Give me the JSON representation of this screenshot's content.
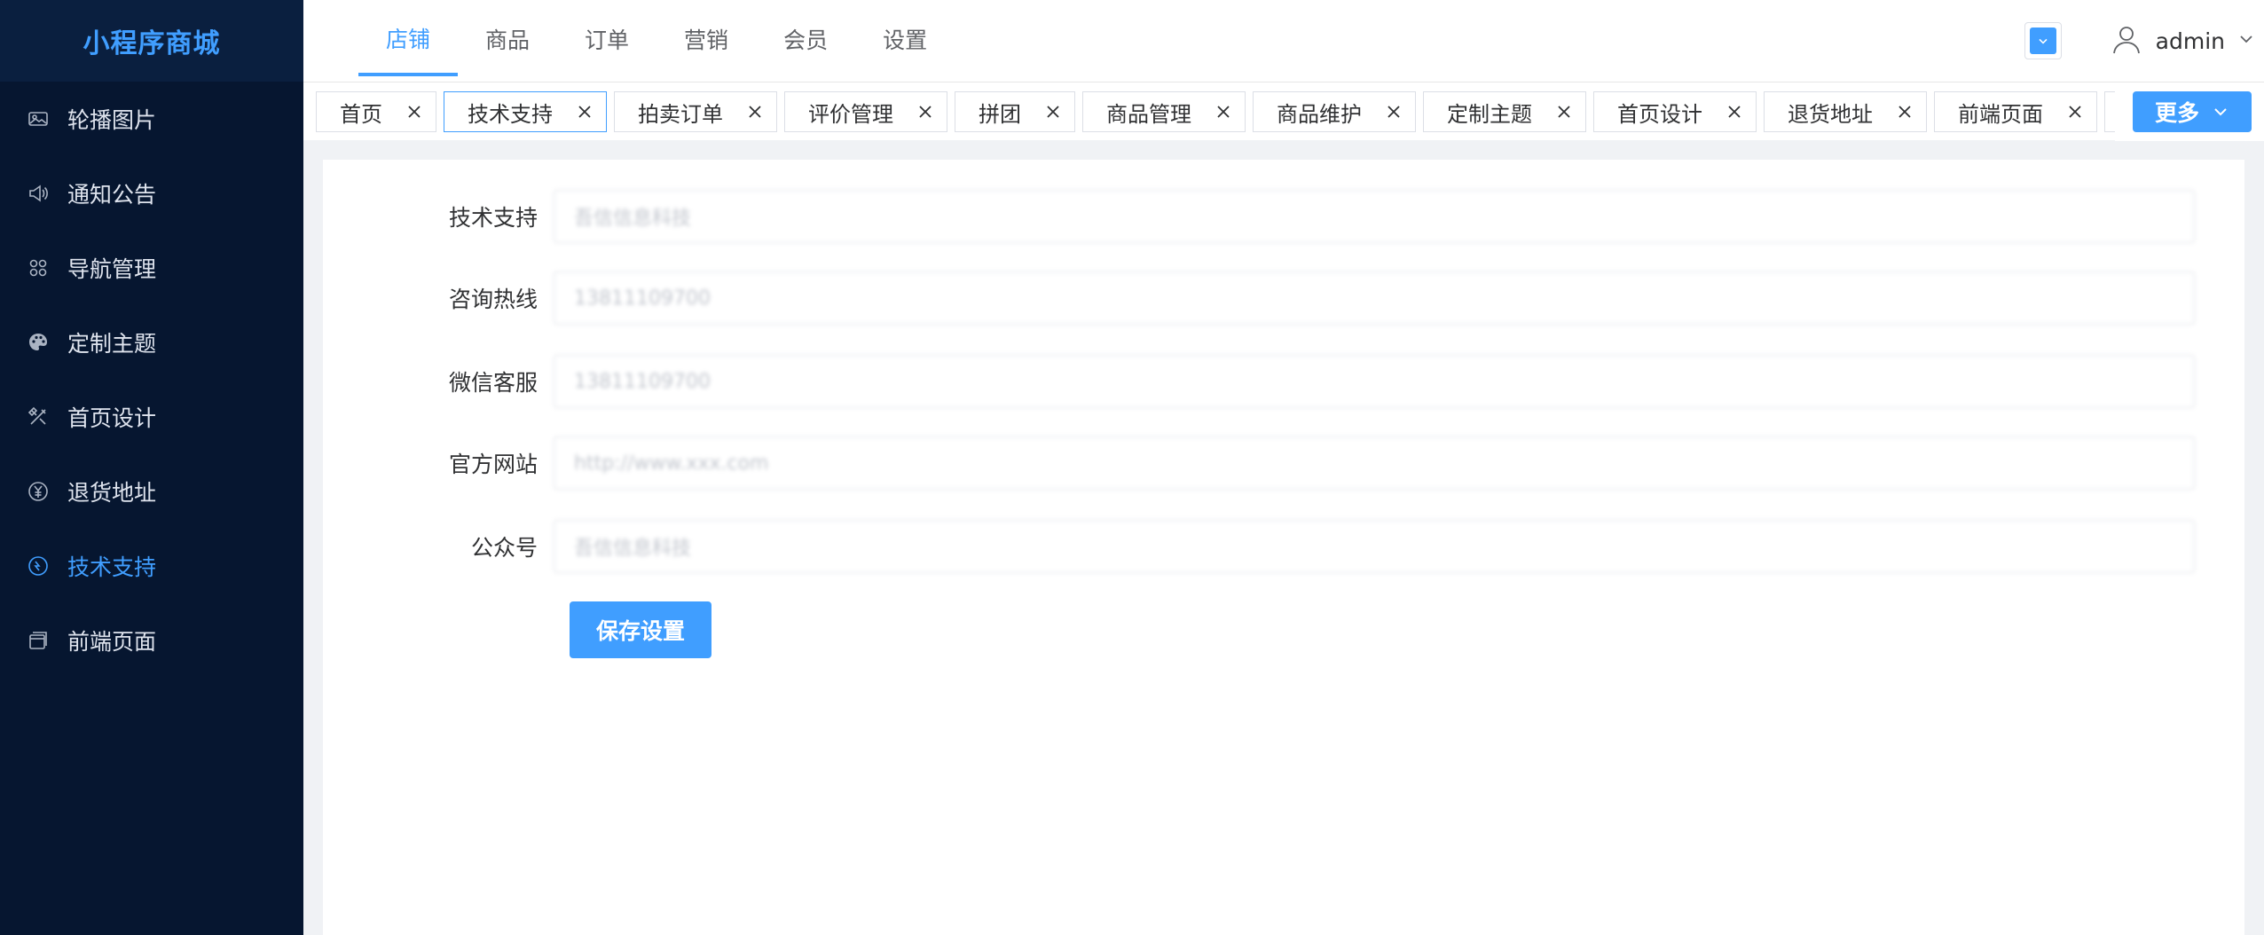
{
  "sidebar": {
    "logo": "小程序商城",
    "items": [
      {
        "label": "轮播图片",
        "icon": "picture-icon"
      },
      {
        "label": "通知公告",
        "icon": "speaker-icon"
      },
      {
        "label": "导航管理",
        "icon": "grid-icon"
      },
      {
        "label": "定制主题",
        "icon": "palette-icon"
      },
      {
        "label": "首页设计",
        "icon": "design-tools-icon"
      },
      {
        "label": "退货地址",
        "icon": "yen-circle-icon"
      },
      {
        "label": "技术支持",
        "icon": "support-icon",
        "active": true
      },
      {
        "label": "前端页面",
        "icon": "pages-icon"
      }
    ]
  },
  "header": {
    "nav": [
      "店铺",
      "商品",
      "订单",
      "营销",
      "会员",
      "设置"
    ],
    "active_nav": "店铺",
    "user": "admin"
  },
  "tabs": {
    "items": [
      "首页",
      "技术支持",
      "拍卖订单",
      "评价管理",
      "拼团",
      "商品管理",
      "商品维护",
      "定制主题",
      "首页设计",
      "退货地址",
      "前端页面"
    ],
    "active": "技术支持",
    "more_label": "更多"
  },
  "form": {
    "fields": [
      {
        "label": "技术支持",
        "value": "吾信信息科技"
      },
      {
        "label": "咨询热线",
        "value": "13811109700"
      },
      {
        "label": "微信客服",
        "value": "13811109700"
      },
      {
        "label": "官方网站",
        "value": "http://www.xxx.com"
      },
      {
        "label": "公众号",
        "value": "吾信信息科技"
      }
    ],
    "save_label": "保存设置"
  },
  "colors": {
    "accent": "#409eff",
    "sidebar_bg": "#061630",
    "logo_bg": "#0a1f3f"
  }
}
